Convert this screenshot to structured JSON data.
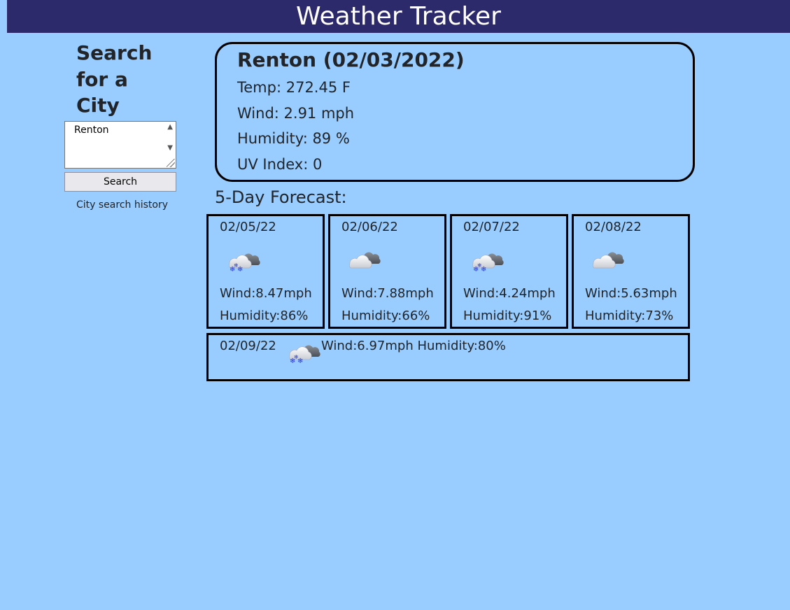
{
  "header": {
    "title": "Weather Tracker"
  },
  "sidebar": {
    "title": "Search for a City",
    "search_value": "Renton",
    "search_button": "Search",
    "history_label": "City search history"
  },
  "current": {
    "title": "Renton (02/03/2022)",
    "temp": "Temp: 272.45 F",
    "wind": "Wind: 2.91 mph",
    "humidity": "Humidity: 89 %",
    "uv": "UV Index: 0"
  },
  "forecast_heading": "5-Day Forecast:",
  "forecast": [
    {
      "date": "02/05/22",
      "icon": "snow-cloud-icon",
      "wind": "Wind:8.47mph",
      "humidity": "Humidity:86%"
    },
    {
      "date": "02/06/22",
      "icon": "cloud-icon",
      "wind": "Wind:7.88mph",
      "humidity": "Humidity:66%"
    },
    {
      "date": "02/07/22",
      "icon": "snow-cloud-icon",
      "wind": "Wind:4.24mph",
      "humidity": "Humidity:91%"
    },
    {
      "date": "02/08/22",
      "icon": "cloud-icon",
      "wind": "Wind:5.63mph",
      "humidity": "Humidity:73%"
    },
    {
      "date": "02/09/22",
      "icon": "snow-cloud-icon",
      "wind": "Wind:6.97mph",
      "humidity": "Humidity:80%"
    }
  ],
  "colors": {
    "background": "#99ccff",
    "header": "#2d2a6b",
    "snow": "#2b3bd1"
  }
}
